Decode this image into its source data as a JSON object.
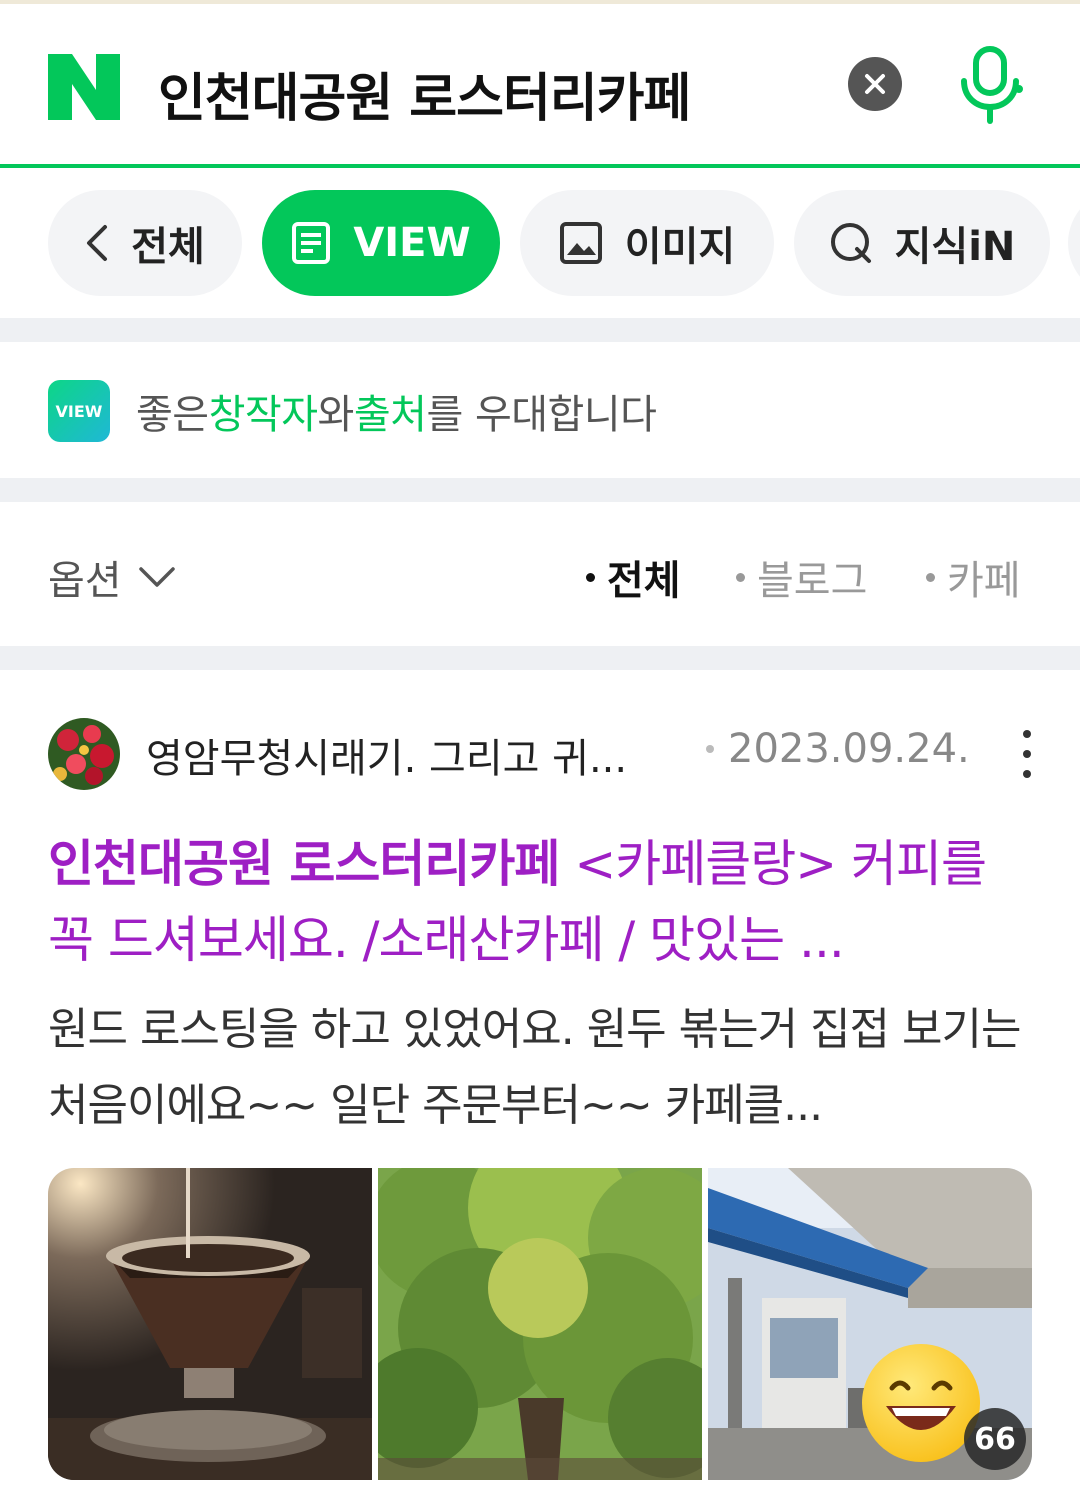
{
  "search": {
    "logo_letter": "N",
    "query": "인천대공원 로스터리카페",
    "clear_icon": "close-icon",
    "mic_icon": "microphone-icon"
  },
  "tabs": [
    {
      "label": "전체",
      "icon": "chevron-left-icon",
      "active": false
    },
    {
      "label": "VIEW",
      "icon": "document-icon",
      "active": true
    },
    {
      "label": "이미지",
      "icon": "image-icon",
      "active": false
    },
    {
      "label": "지식iN",
      "icon": "q-icon",
      "active": false
    }
  ],
  "banner": {
    "badge": "VIEW",
    "text_1": "좋은",
    "text_hl_1": "창작자",
    "text_2": "와",
    "text_hl_2": "출처",
    "text_3": "를 우대합니다"
  },
  "options": {
    "toggle_label": "옵션",
    "filters": [
      {
        "label": "전체",
        "active": true
      },
      {
        "label": "블로그",
        "active": false
      },
      {
        "label": "카페",
        "active": false
      }
    ]
  },
  "post": {
    "author": "영암무청시래기. 그리고 귀...",
    "date": "2023.09.24.",
    "title_bold": "인천대공원 로스터리카페",
    "title_rest": " <카페클랑> 커피를 꼭 드셔보세요. /소래산카페 / 맛있는 ...",
    "snippet": "원드 로스팅을 하고 있었어요. 원두 볶는거 집접 보기는 처음이에요~~ 일단 주문부터~~ 카페클...",
    "image_count": "66"
  },
  "colors": {
    "brand_green": "#03c75a",
    "title_purple": "#9e1fc4"
  }
}
